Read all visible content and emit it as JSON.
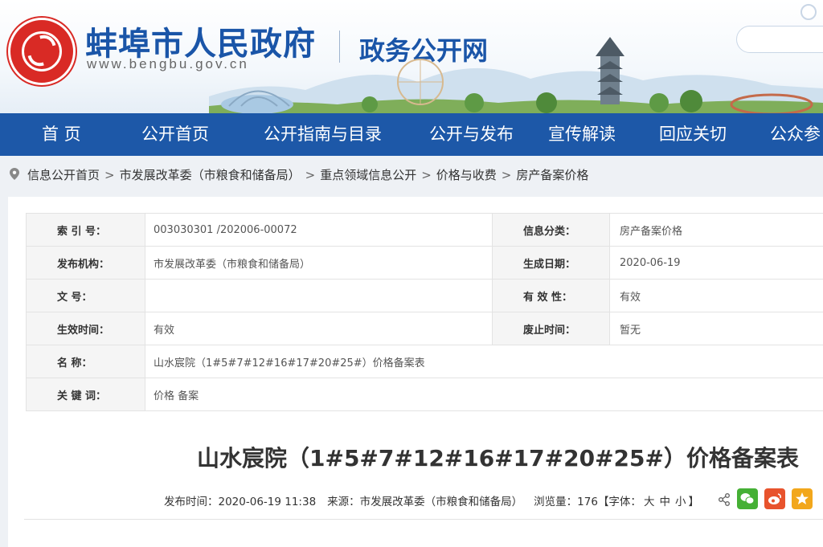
{
  "header": {
    "site_title": "蚌埠市人民政府",
    "site_url": "www.bengbu.gov.cn",
    "sub_title": "政务公开网"
  },
  "nav": {
    "items": [
      "首  页",
      "公开首页",
      "公开指南与目录",
      "公开与发布",
      "宣传解读",
      "回应关切",
      "公众参"
    ]
  },
  "breadcrumb": {
    "items": [
      "信息公开首页",
      "市发展改革委（市粮食和储备局）",
      "重点领域信息公开",
      "价格与收费",
      "房产备案价格"
    ],
    "separator": ">"
  },
  "meta": {
    "index_label": "索 引 号：",
    "index_value": "003030301 /202006-00072",
    "category_label": "信息分类：",
    "category_value": "房产备案价格",
    "publisher_label": "发布机构：",
    "publisher_value": "市发展改革委（市粮食和储备局）",
    "date_label": "生成日期：",
    "date_value": "2020-06-19",
    "docno_label": "文      号：",
    "docno_value": "",
    "validity_label": "有 效 性：",
    "validity_value": "有效",
    "effective_label": "生效时间：",
    "effective_value": "有效",
    "abolish_label": "废止时间：",
    "abolish_value": "暂无",
    "name_label": "名      称：",
    "name_value": "山水宸院（1#5#7#12#16#17#20#25#）价格备案表",
    "keywords_label": "关 键 词：",
    "keywords_value": "价格 备案"
  },
  "document": {
    "title": "山水宸院（1#5#7#12#16#17#20#25#）价格备案表",
    "publish_time_label": "发布时间：",
    "publish_time": "2020-06-19 11:38",
    "source_label": "来源：",
    "source": "市发展改革委（市粮食和储备局）",
    "views_label": "浏览量：",
    "views": "176",
    "font_label_open": "【字体：",
    "font_large": "大",
    "font_medium": "中",
    "font_small": "小",
    "font_label_close": "】"
  },
  "colors": {
    "brand_blue": "#1d58a8",
    "logo_red": "#d92a25",
    "wechat_green": "#45b035",
    "weibo_orange": "#e8532d",
    "favorite_yellow": "#f2a71c"
  },
  "icons": [
    "location-pin-icon",
    "share-icon",
    "wechat-icon",
    "weibo-icon",
    "favorite-icon"
  ]
}
